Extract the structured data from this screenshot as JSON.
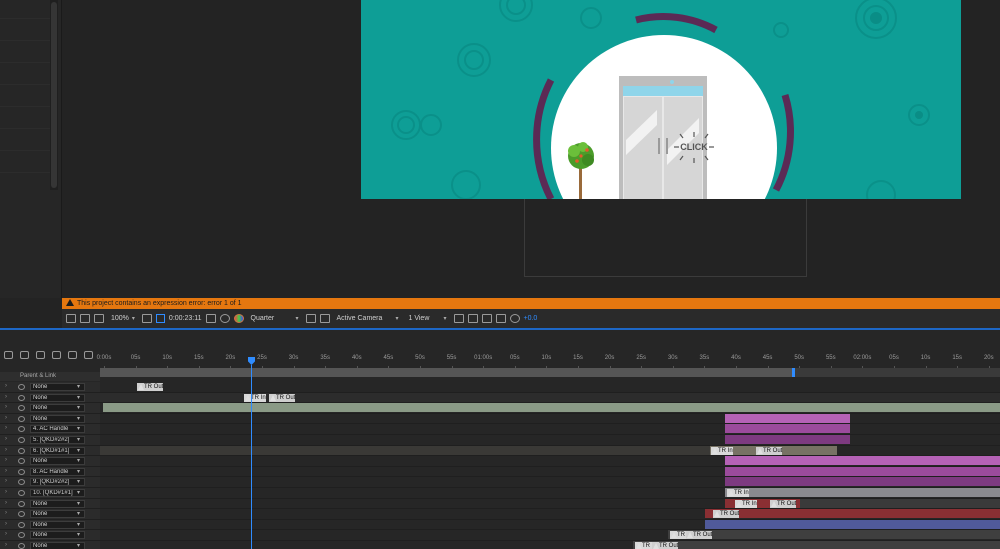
{
  "error_message": "This project contains an expression error: error 1 of 1",
  "viewer_toolbar": {
    "zoom": "100%",
    "timecode": "0:00:23:11",
    "resolution": "Quarter",
    "camera": "Active Camera",
    "view": "1 View",
    "exposure": "+0.0"
  },
  "comp_artwork": {
    "click_text": "CLICK",
    "bg_color": "#0e9e96",
    "ring_color": "#5b2a55"
  },
  "timeline": {
    "column_header": "Parent & Link",
    "ruler_ticks": [
      "0:00s",
      "05s",
      "10s",
      "15s",
      "20s",
      "25s",
      "30s",
      "35s",
      "40s",
      "45s",
      "50s",
      "55s",
      "01:00s",
      "05s",
      "10s",
      "15s",
      "20s",
      "25s",
      "30s",
      "35s",
      "40s",
      "45s",
      "50s",
      "55s",
      "02:00s",
      "05s",
      "10s",
      "15s",
      "20s"
    ],
    "layers": [
      {
        "parent": "None"
      },
      {
        "parent": "None"
      },
      {
        "parent": "None"
      },
      {
        "parent": "None"
      },
      {
        "parent": "4. AC Handle"
      },
      {
        "parent": "5. [QKD#2#2]"
      },
      {
        "parent": "6. [QKD#1#1]"
      },
      {
        "parent": "None"
      },
      {
        "parent": "8. AC Handle"
      },
      {
        "parent": "9. [QKD#2#2]"
      },
      {
        "parent": "10. [QKD#1#1]"
      },
      {
        "parent": "None"
      },
      {
        "parent": "None"
      },
      {
        "parent": "None"
      },
      {
        "parent": "None"
      },
      {
        "parent": "None"
      }
    ],
    "markers": {
      "tr_in": "TR In",
      "tr_out": "TR Out"
    }
  }
}
